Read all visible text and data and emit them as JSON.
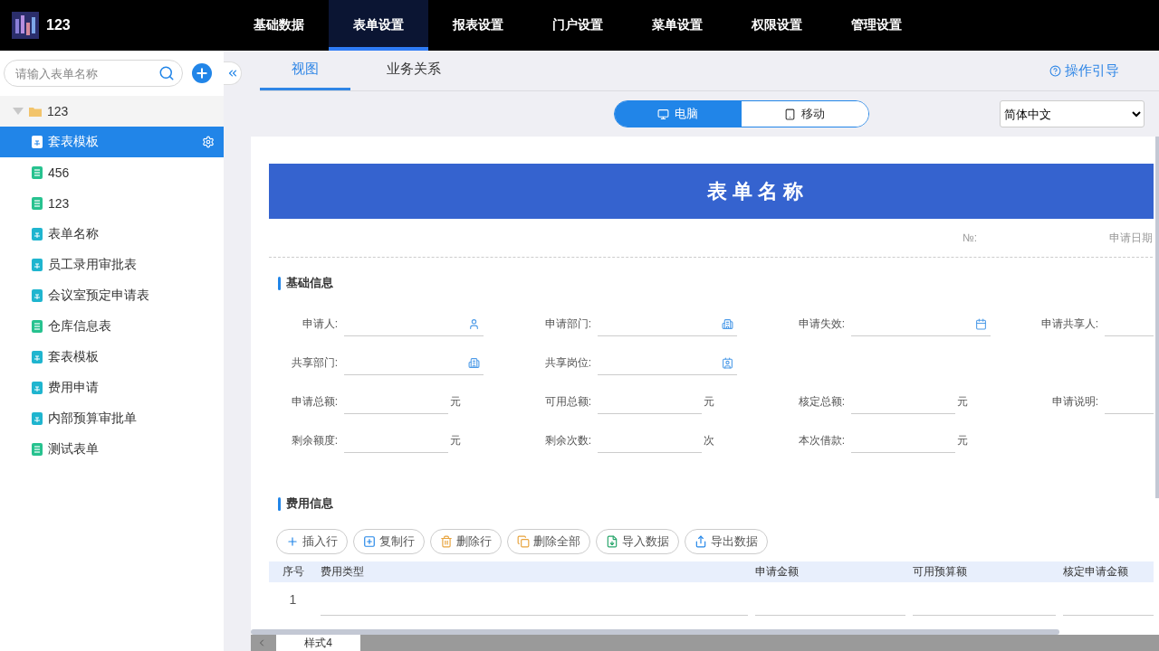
{
  "app": {
    "title": "123"
  },
  "nav": [
    {
      "label": "基础数据",
      "selected": false
    },
    {
      "label": "表单设置",
      "selected": true
    },
    {
      "label": "报表设置",
      "selected": false
    },
    {
      "label": "门户设置",
      "selected": false
    },
    {
      "label": "菜单设置",
      "selected": false
    },
    {
      "label": "权限设置",
      "selected": false
    },
    {
      "label": "管理设置",
      "selected": false
    }
  ],
  "sidebar": {
    "search": {
      "placeholder": "请输入表单名称"
    },
    "tree": [
      {
        "label": "123",
        "expanded": true,
        "children": [
          {
            "label": "套表模板",
            "kind": "form",
            "selected": true
          },
          {
            "label": "456",
            "kind": "list",
            "selected": false
          },
          {
            "label": "123",
            "kind": "list",
            "selected": false
          },
          {
            "label": "表单名称",
            "kind": "form",
            "selected": false
          },
          {
            "label": "员工录用审批表",
            "kind": "form",
            "selected": false
          },
          {
            "label": "会议室预定申请表",
            "kind": "form",
            "selected": false
          },
          {
            "label": "仓库信息表",
            "kind": "list",
            "selected": false
          },
          {
            "label": "套表模板",
            "kind": "form",
            "selected": false
          },
          {
            "label": "费用申请",
            "kind": "form",
            "selected": false
          },
          {
            "label": "内部预算审批单",
            "kind": "form",
            "selected": false
          },
          {
            "label": "测试表单",
            "kind": "list",
            "selected": false
          }
        ]
      }
    ]
  },
  "tabs": [
    {
      "label": "视图",
      "selected": true
    },
    {
      "label": "业务关系",
      "selected": false
    }
  ],
  "help_link": "操作引导",
  "device_toggle": [
    {
      "label": "电脑",
      "kind": "desktop",
      "selected": true
    },
    {
      "label": "移动",
      "kind": "mobile",
      "selected": false
    }
  ],
  "language": "简体中文",
  "form": {
    "title": "表单名称",
    "number_label": "№:",
    "date_label": "申请日期",
    "basic": {
      "title": "基础信息",
      "rows": [
        [
          {
            "label": "申请人:",
            "kind": "person"
          },
          {
            "label": "申请部门:",
            "kind": "department"
          },
          {
            "label": "申请失效:",
            "kind": "date"
          },
          {
            "label": "申请共享人:",
            "kind": "text"
          }
        ],
        [
          {
            "label": "共享部门:",
            "kind": "departments"
          },
          {
            "label": "共享岗位:",
            "kind": "position"
          }
        ],
        [
          {
            "label": "申请总额:",
            "kind": "unit",
            "unit": "元"
          },
          {
            "label": "可用总额:",
            "kind": "unit",
            "unit": "元"
          },
          {
            "label": "核定总额:",
            "kind": "unit",
            "unit": "元"
          },
          {
            "label": "申请说明:",
            "kind": "text"
          }
        ],
        [
          {
            "label": "剩余额度:",
            "kind": "unit",
            "unit": "元"
          },
          {
            "label": "剩余次数:",
            "kind": "unit",
            "unit": "次"
          },
          {
            "label": "本次借款:",
            "kind": "unit",
            "unit": "元"
          }
        ]
      ]
    },
    "expense": {
      "title": "费用信息",
      "buttons": [
        {
          "label": "插入行",
          "kind": "insert"
        },
        {
          "label": "复制行",
          "kind": "copy"
        },
        {
          "label": "删除行",
          "kind": "delete"
        },
        {
          "label": "删除全部",
          "kind": "delete_all"
        },
        {
          "label": "导入数据",
          "kind": "import"
        },
        {
          "label": "导出数据",
          "kind": "export"
        }
      ],
      "columns": [
        "序号",
        "费用类型",
        "申请金额",
        "可用预算额",
        "核定申请金额"
      ],
      "rows": [
        {
          "index": "1"
        }
      ]
    }
  },
  "sheet_tabs": [
    {
      "label": "样式4",
      "selected": true
    }
  ]
}
